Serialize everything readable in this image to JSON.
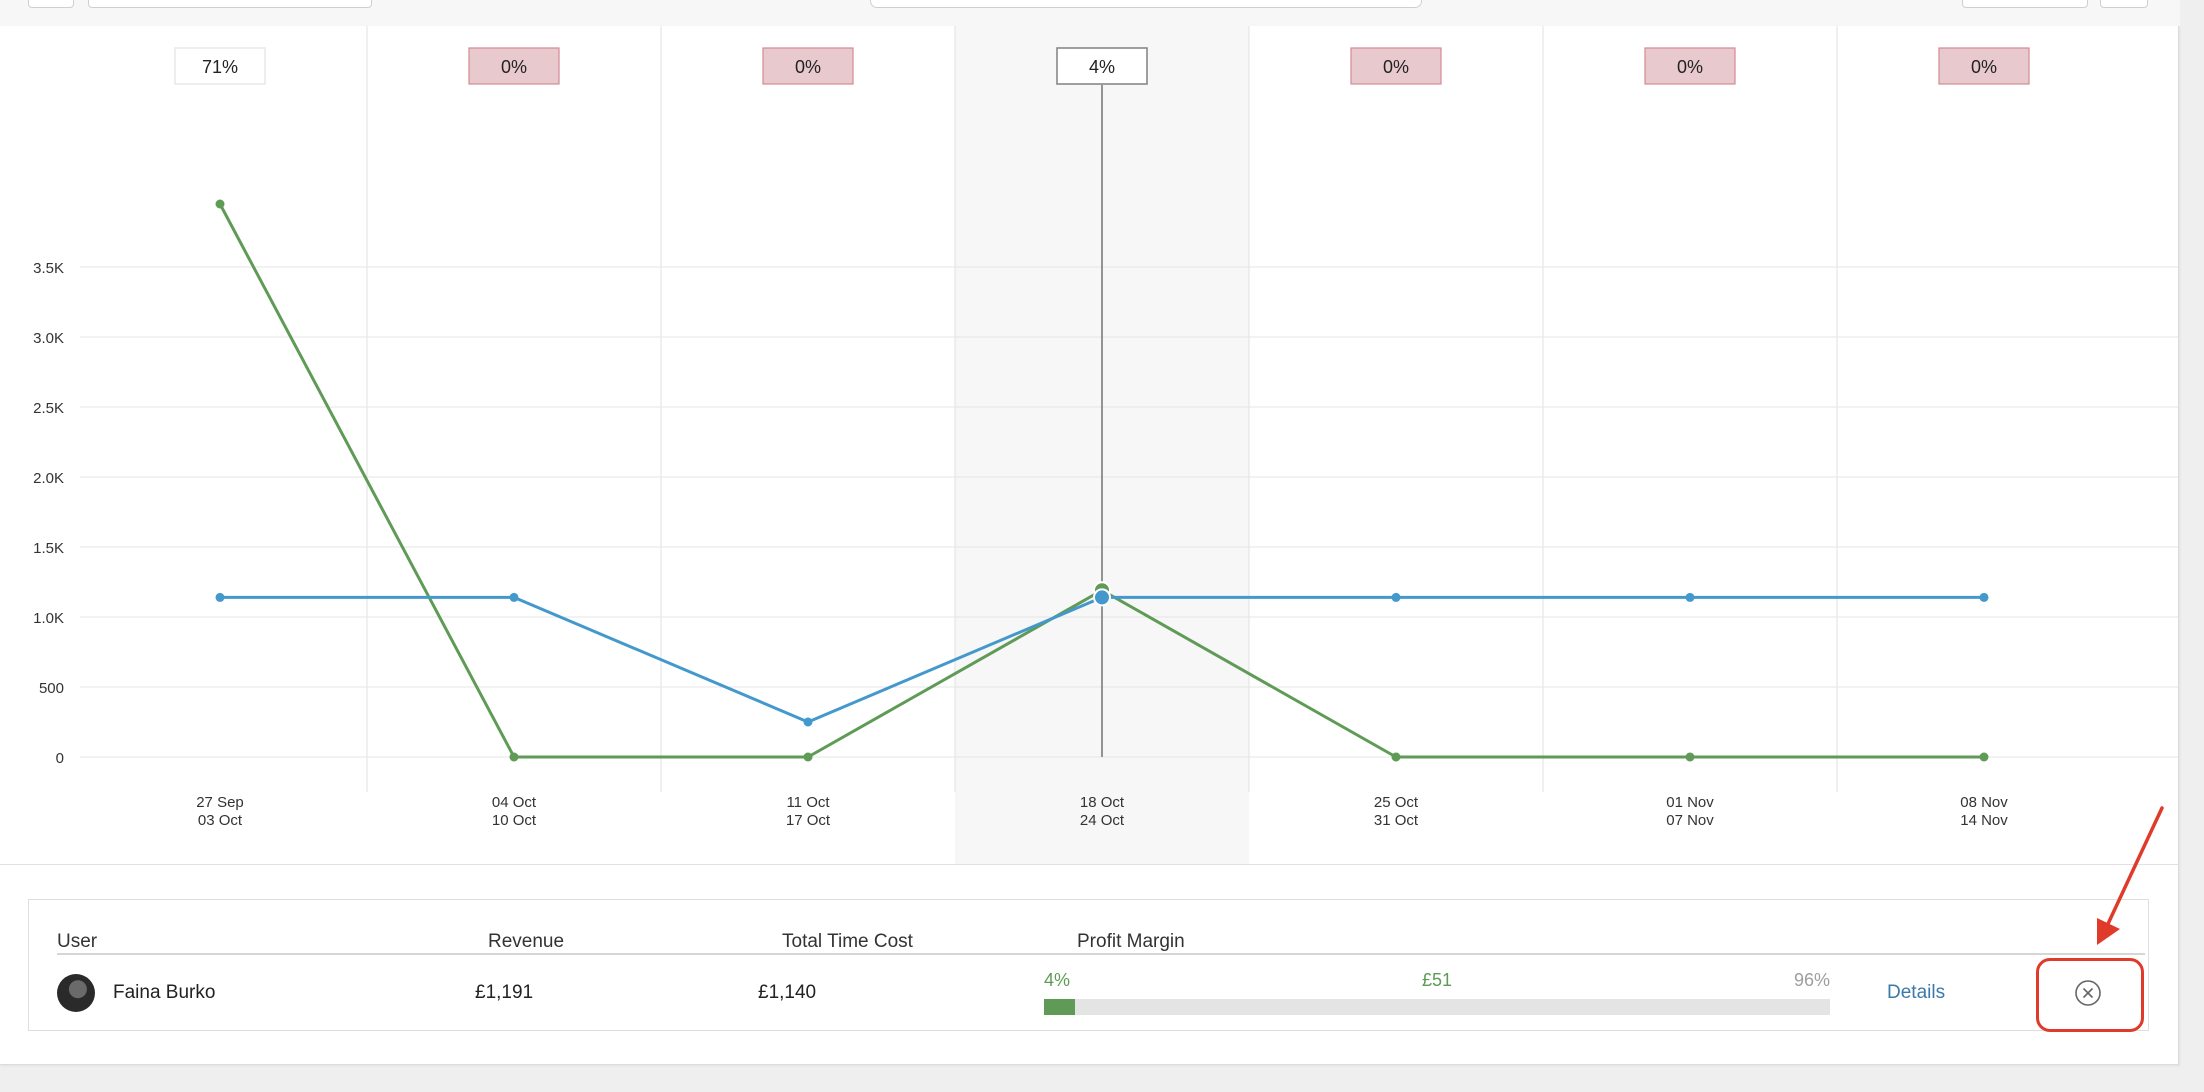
{
  "colors": {
    "revenue_line": "#5f9a56",
    "cost_line": "#4499cc",
    "negative_box": "#e8c9cd",
    "annotation": "#e03a2b"
  },
  "chart_data": {
    "type": "line",
    "categories": [
      "27 Sep|03 Oct",
      "04 Oct|10 Oct",
      "11 Oct|17 Oct",
      "18 Oct|24 Oct",
      "25 Oct|31 Oct",
      "01 Nov|07 Nov",
      "08 Nov|14 Nov"
    ],
    "category_lines": [
      [
        "27 Sep",
        "03 Oct"
      ],
      [
        "04 Oct",
        "10 Oct"
      ],
      [
        "11 Oct",
        "17 Oct"
      ],
      [
        "18 Oct",
        "24 Oct"
      ],
      [
        "25 Oct",
        "31 Oct"
      ],
      [
        "01 Nov",
        "07 Nov"
      ],
      [
        "08 Nov",
        "14 Nov"
      ]
    ],
    "series": [
      {
        "key": "revenue",
        "color": "#5f9a56",
        "values": [
          3950,
          0,
          0,
          1191,
          0,
          0,
          0
        ]
      },
      {
        "key": "cost",
        "color": "#4499cc",
        "values": [
          1140,
          1140,
          250,
          1140,
          1140,
          1140,
          1140
        ]
      }
    ],
    "margins": [
      "71%",
      "0%",
      "0%",
      "4%",
      "0%",
      "0%",
      "0%"
    ],
    "margin_negative": [
      false,
      true,
      true,
      false,
      true,
      true,
      true
    ],
    "ylim": [
      0,
      4000
    ],
    "yticks": [
      0,
      500,
      1000,
      1500,
      2000,
      2500,
      3000,
      3500
    ],
    "ytick_labels": [
      "0",
      "500",
      "1.0K",
      "1.5K",
      "2.0K",
      "2.5K",
      "3.0K",
      "3.5K"
    ],
    "grid": true,
    "highlighted_index": 3
  },
  "table": {
    "headers": {
      "user": "User",
      "revenue": "Revenue",
      "total_time_cost": "Total Time Cost",
      "profit_margin": "Profit Margin"
    },
    "rows": [
      {
        "user": "Faina Burko",
        "revenue": "£1,191",
        "total_time_cost": "£1,140",
        "margin_percent_label": "4%",
        "profit_label": "£51",
        "remaining_percent_label": "96%",
        "margin_fraction": 0.04,
        "details_label": "Details"
      }
    ]
  },
  "icons": {
    "close": "close-circle-icon",
    "avatar": "avatar"
  }
}
